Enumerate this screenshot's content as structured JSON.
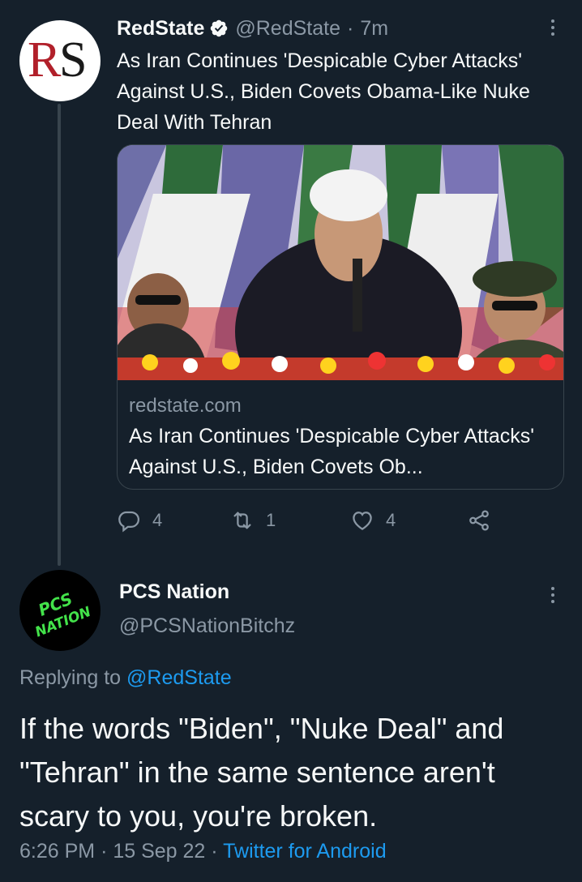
{
  "tweet1": {
    "avatar_text": [
      "R",
      "S"
    ],
    "name": "RedState",
    "handle": "@RedState",
    "separator": "·",
    "time": "7m",
    "text": "As Iran Continues 'Despicable Cyber Attacks' Against U.S., Biden Covets Obama-Like Nuke Deal With Tehran",
    "card": {
      "domain": "redstate.com",
      "title": "As Iran Continues 'Despicable Cyber Attacks' Against U.S., Biden Covets Ob..."
    },
    "actions": {
      "replies": "4",
      "retweets": "1",
      "likes": "4"
    },
    "verified_color": "#f7f9f9",
    "icons": [
      "verified-badge-icon",
      "more-icon",
      "reply-icon",
      "retweet-icon",
      "like-icon",
      "share-icon"
    ]
  },
  "tweet2": {
    "avatar_text": [
      "PCS",
      "NATION"
    ],
    "name": "PCS Nation",
    "handle": "@PCSNationBitchz",
    "replying_prefix": "Replying to",
    "replying_to": "@RedState",
    "text": "If the words \"Biden\", \"Nuke Deal\" and \"Tehran\" in the same sentence aren't scary to you, you're broken.",
    "time": "6:26 PM",
    "date": "15 Sep 22",
    "separator": "·",
    "source": "Twitter for Android"
  },
  "colors": {
    "background": "#15202b",
    "accent": "#1d9bf0",
    "secondary_text": "#8b98a5",
    "border": "#38444d",
    "pcs_green": "#43e24a"
  }
}
